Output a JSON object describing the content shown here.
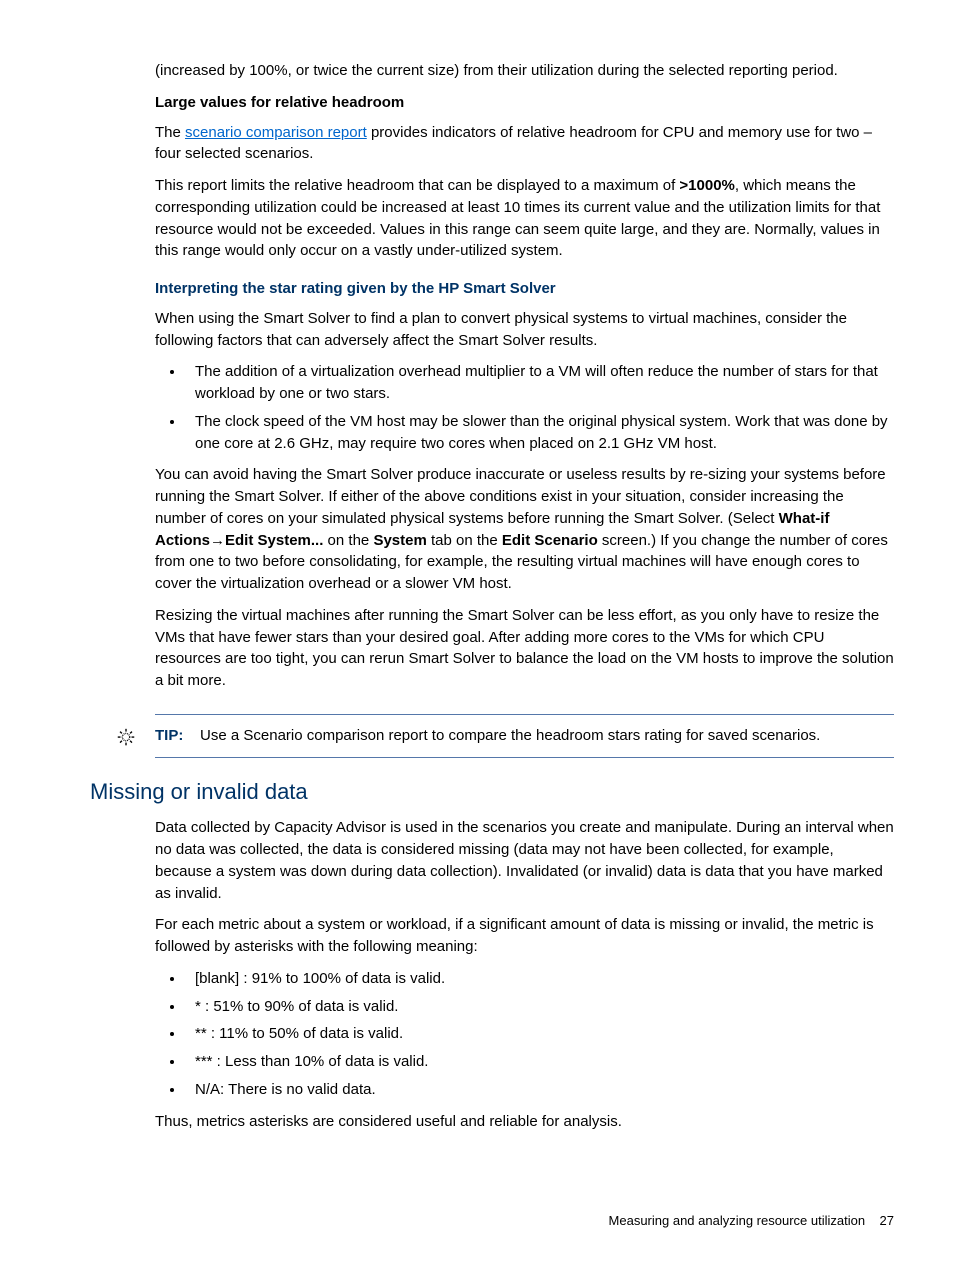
{
  "intro": {
    "p1": "(increased by 100%, or twice the current size) from their utilization during the selected reporting period."
  },
  "section1": {
    "heading": "Large values for relative headroom",
    "p1_pre": "The ",
    "p1_link": "scenario comparison report",
    "p1_post": " provides indicators of relative headroom for CPU and memory use for two – four selected scenarios.",
    "p2_a": "This report limits the relative headroom that can be displayed to a maximum of ",
    "p2_bold": ">1000%",
    "p2_b": ", which means the corresponding utilization could be increased at least 10 times its current value and the utilization limits for that resource would not be exceeded. Values in this range can seem quite large, and they are. Normally, values in this range would only occur on a vastly under-utilized system."
  },
  "section2": {
    "heading": "Interpreting the star rating given by the HP Smart Solver",
    "p1": "When using the Smart Solver to find a plan to convert physical systems to virtual machines, consider the following factors that can adversely affect the Smart Solver results.",
    "bullets": [
      "The addition of a virtualization overhead multiplier to a VM will often reduce the number of stars for that workload by one or two stars.",
      "The clock speed of the VM host may be slower than the original physical system. Work that was done by one core at 2.6 GHz, may require two cores when placed on 2.1 GHz VM host."
    ],
    "p2_a": "You can avoid having the Smart Solver produce inaccurate or useless results by re-sizing your systems before running the Smart Solver. If either of the above conditions exist in your situation, consider increasing the number of cores on your simulated physical systems before running the Smart Solver. (Select ",
    "p2_bold1": "What-if Actions",
    "p2_arrow": "→",
    "p2_bold2": "Edit System...",
    "p2_b": " on the ",
    "p2_bold3": "System",
    "p2_c": " tab on the ",
    "p2_bold4": "Edit Scenario",
    "p2_d": " screen.) If you change the number of cores from one to two before consolidating, for example, the resulting virtual machines will have enough cores to cover the virtualization overhead or a slower VM host.",
    "p3": "Resizing the virtual machines after running the Smart Solver can be less effort, as you only have to resize the VMs that have fewer stars than your desired goal. After adding more cores to the VMs for which CPU resources are too tight, you can rerun Smart Solver to balance the load on the VM hosts to improve the solution a bit more."
  },
  "tip": {
    "label": "TIP:",
    "text": "Use a Scenario comparison report to compare the headroom stars rating for saved scenarios."
  },
  "section3": {
    "heading": "Missing or invalid data",
    "p1": "Data collected by Capacity Advisor is used in the scenarios you create and manipulate. During an interval when no data was collected, the data is considered missing (data may not have been collected, for example, because a system was down during data collection). Invalidated (or invalid) data is data that you have marked as invalid.",
    "p2": "For each metric about a system or workload, if a significant amount of data is missing or invalid, the metric is followed by asterisks with the following meaning:",
    "bullets": [
      "[blank] : 91% to 100% of data is valid.",
      "* : 51% to 90% of data is valid.",
      "** : 11% to 50% of data is valid.",
      "*** : Less than 10% of data is valid.",
      "N/A: There is no valid data."
    ],
    "p3": "Thus, metrics asterisks are considered useful and reliable for analysis."
  },
  "footer": {
    "text": "Measuring and analyzing resource utilization",
    "page": "27"
  }
}
